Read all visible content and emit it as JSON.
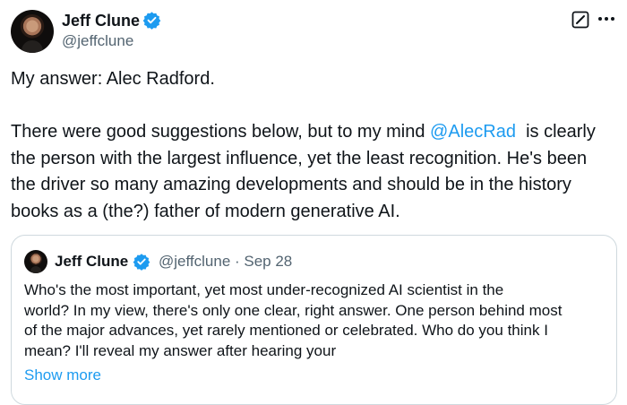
{
  "author": {
    "name": "Jeff Clune",
    "handle": "@jeffclune"
  },
  "tweet": {
    "line1": "My answer: Alec Radford.",
    "p2_line1_before": "There were good suggestions below, but to my mind ",
    "mention": "@AlecRad",
    "p2_line1_after": "  is clearly",
    "p2_line2": "the person with the largest influence, yet the least recognition. He's been",
    "p2_line3": "the driver so many amazing developments and should be in the history",
    "p2_line4": "books as a (the?) father of modern generative AI."
  },
  "quoted": {
    "name": "Jeff Clune",
    "handle_date": "@jeffclune · Sep 28",
    "line1": "Who's the most important, yet most under-recognized AI scientist in the",
    "line2": "world? In my view, there's only one clear, right answer. One person behind most",
    "line3": "of the major advances, yet rarely mentioned or celebrated. Who do you think I",
    "line4": "mean? I'll reveal my answer after hearing your",
    "show_more": "Show more"
  },
  "colors": {
    "accent": "#1d9bf0",
    "text": "#0f1419",
    "secondary": "#536471",
    "border": "#cfd9de"
  },
  "icons": [
    "verified-icon",
    "edit-icon",
    "more-icon"
  ]
}
